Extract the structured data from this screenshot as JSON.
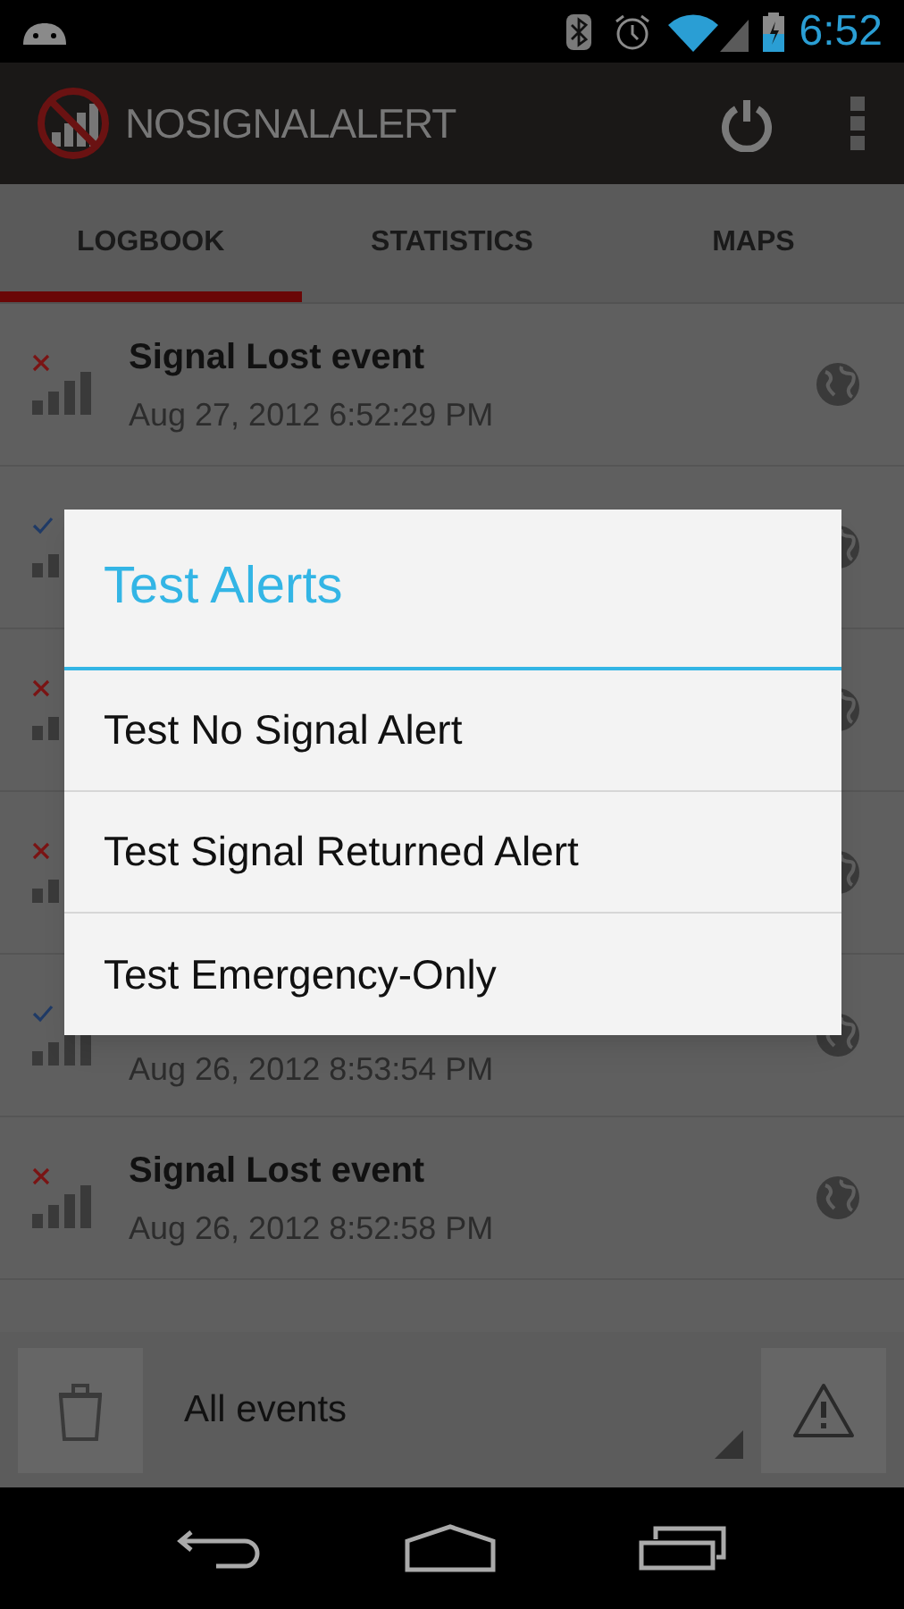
{
  "status_bar": {
    "time": "6:52"
  },
  "action_bar": {
    "title": "NOSIGNALALERT"
  },
  "tabs": [
    {
      "label": "LOGBOOK",
      "selected": true
    },
    {
      "label": "STATISTICS",
      "selected": false
    },
    {
      "label": "MAPS",
      "selected": false
    }
  ],
  "events": [
    {
      "kind": "lost",
      "title": "Signal Lost event",
      "date": "Aug 27, 2012 6:52:29 PM"
    },
    {
      "kind": "returned"
    },
    {
      "kind": "lost"
    },
    {
      "kind": "lost"
    },
    {
      "kind": "returned",
      "date": "Aug 26, 2012 8:53:54 PM"
    },
    {
      "kind": "lost",
      "title": "Signal Lost event",
      "date": "Aug 26, 2012 8:52:58 PM"
    }
  ],
  "filter": {
    "value": "All events"
  },
  "dialog": {
    "title": "Test Alerts",
    "items": [
      "Test No Signal Alert",
      "Test Signal Returned Alert",
      "Test Emergency-Only"
    ]
  }
}
